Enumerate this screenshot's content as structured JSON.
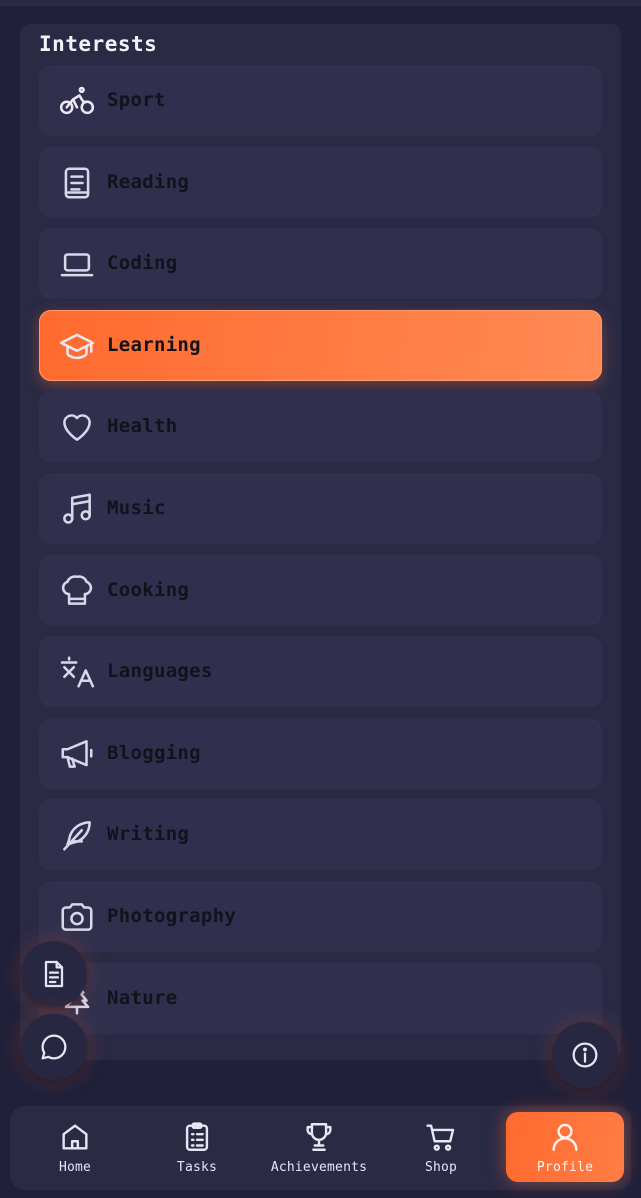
{
  "section": {
    "title": "Interests"
  },
  "interests": [
    {
      "label": "Sport",
      "icon": "bicycle-icon",
      "active": true
    },
    {
      "label": "Reading",
      "icon": "book-icon",
      "active": false
    },
    {
      "label": "Coding",
      "icon": "laptop-icon",
      "active": false
    },
    {
      "label": "Learning",
      "icon": "graduation-cap-icon",
      "active": true
    },
    {
      "label": "Health",
      "icon": "heart-icon",
      "active": false
    },
    {
      "label": "Music",
      "icon": "music-note-icon",
      "active": false
    },
    {
      "label": "Cooking",
      "icon": "chef-hat-icon",
      "active": false
    },
    {
      "label": "Languages",
      "icon": "translate-icon",
      "active": false
    },
    {
      "label": "Blogging",
      "icon": "megaphone-icon",
      "active": false
    },
    {
      "label": "Writing",
      "icon": "feather-icon",
      "active": false
    },
    {
      "label": "Photography",
      "icon": "camera-icon",
      "active": false
    },
    {
      "label": "Nature",
      "icon": "tree-icon",
      "active": false
    }
  ],
  "fabs": {
    "notes_icon": "document-icon",
    "chat_icon": "chat-bubble-icon",
    "info_icon": "info-icon"
  },
  "nav": {
    "items": [
      {
        "label": "Home",
        "icon": "home-icon",
        "active": false
      },
      {
        "label": "Tasks",
        "icon": "clipboard-icon",
        "active": false
      },
      {
        "label": "Achievements",
        "icon": "trophy-icon",
        "active": false
      },
      {
        "label": "Shop",
        "icon": "cart-icon",
        "active": false
      },
      {
        "label": "Profile",
        "icon": "user-icon",
        "active": true
      }
    ]
  },
  "colors": {
    "background": "#20203a",
    "panel": "#2a2a45",
    "item": "#30304e",
    "accent": "#ff6a2e",
    "icon": "#d8d8ea"
  }
}
